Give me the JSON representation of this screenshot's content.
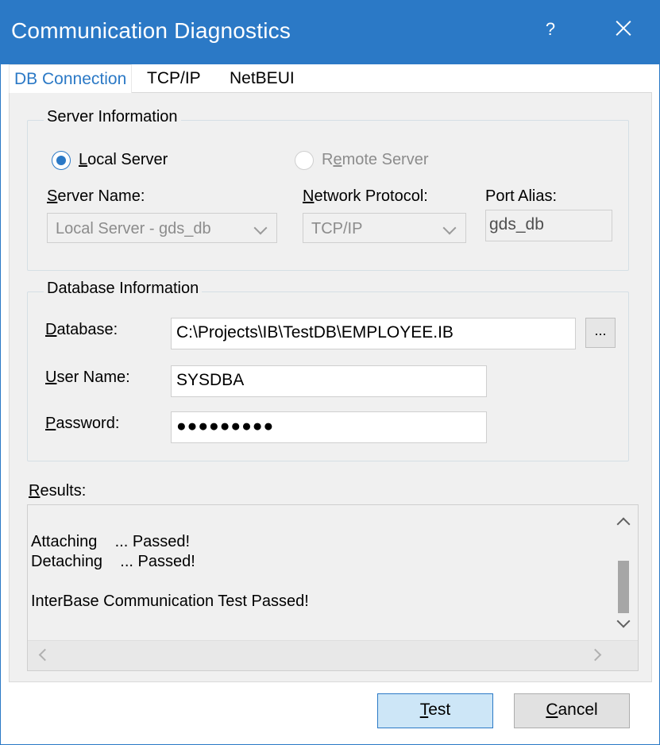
{
  "window": {
    "title": "Communication Diagnostics",
    "help_label": "?",
    "accent_color": "#2b79c6"
  },
  "tabs": [
    {
      "label": "DB Connection",
      "active": true
    },
    {
      "label": "TCP/IP",
      "active": false
    },
    {
      "label": "NetBEUI",
      "active": false
    }
  ],
  "server_info": {
    "legend": "Server Information",
    "local_server": {
      "label_u": "L",
      "label_rest": "ocal Server",
      "checked": true
    },
    "remote_server": {
      "label_a": "R",
      "label_u": "e",
      "label_b": "mote Server",
      "checked": false,
      "disabled": true
    },
    "server_name": {
      "label_u": "S",
      "label_rest": "erver Name:",
      "value": "Local Server - gds_db"
    },
    "network_protocol": {
      "label_u": "N",
      "label_rest": "etwork Protocol:",
      "value": "TCP/IP"
    },
    "port_alias": {
      "label": "Port Alias:",
      "value": "gds_db"
    }
  },
  "database_info": {
    "legend": "Database Information",
    "database": {
      "label_u": "D",
      "label_rest": "atabase:",
      "value": "C:\\Projects\\IB\\TestDB\\EMPLOYEE.IB",
      "browse_label": "..."
    },
    "user_name": {
      "label_u": "U",
      "label_rest": "ser Name:",
      "value": "SYSDBA"
    },
    "password": {
      "label_u": "P",
      "label_rest": "assword:",
      "value": "●●●●●●●●●"
    }
  },
  "results": {
    "label_u": "R",
    "label_rest": "esults:",
    "text": "Attaching    ... Passed!\nDetaching    ... Passed!\n\nInterBase Communication Test Passed!"
  },
  "buttons": {
    "test_u": "T",
    "test_rest": "est",
    "cancel_u": "C",
    "cancel_rest": "ancel"
  }
}
